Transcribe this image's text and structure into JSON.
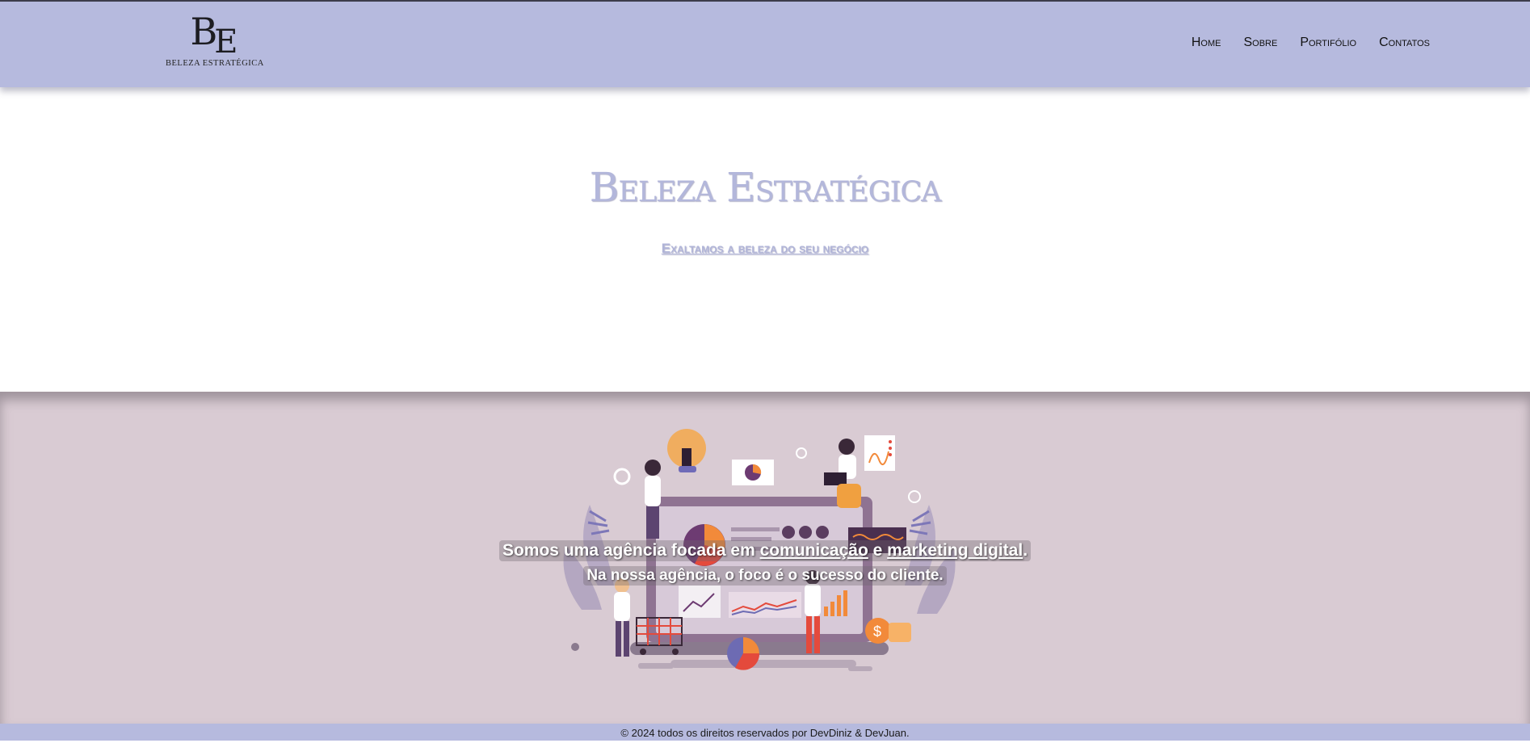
{
  "header": {
    "logo": {
      "mark_b": "B",
      "mark_e": "E",
      "text": "BELEZA ESTRATÉGICA"
    },
    "nav": [
      {
        "label": "Home"
      },
      {
        "label": "Sobre"
      },
      {
        "label": "Portifólio"
      },
      {
        "label": "Contatos"
      }
    ]
  },
  "hero": {
    "title": "Beleza Estratégica",
    "subtitle": "Exaltamos a beleza do seu negócio"
  },
  "about": {
    "line1_pre": "Somos uma agência focada em ",
    "link_comunicacao": "comunicação",
    "line1_mid": " e ",
    "link_marketing": "marketing digital",
    "line1_end": ".",
    "line2": "Na nossa agência, o foco é o sucesso do cliente."
  },
  "footer": {
    "text": "© 2024 todos os direitos reservados por DevDiniz & DevJuan."
  },
  "colors": {
    "header_bg": "#b6bade",
    "band_bg": "#d9cbd3",
    "title": "#b3b7db"
  },
  "icons": [
    "lightbulb-icon",
    "pie-chart-icon",
    "dollar-coin-icon",
    "shopping-cart-icon"
  ]
}
